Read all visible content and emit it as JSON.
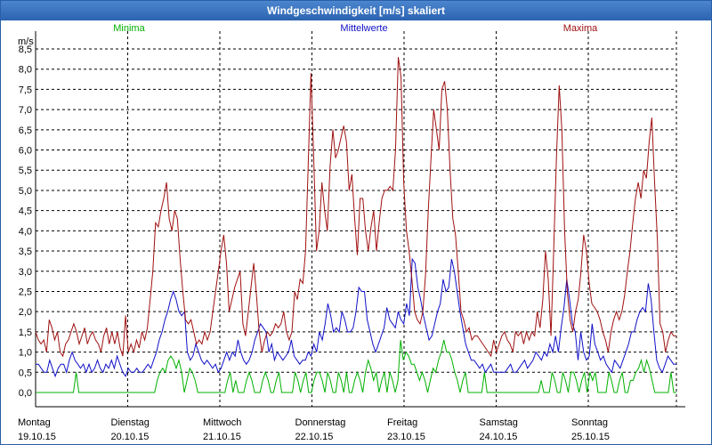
{
  "window": {
    "title": "Windgeschwindigkeit [m/s] skaliert"
  },
  "colors": {
    "min": "#00b000",
    "mean": "#1010c8",
    "max": "#a01010",
    "titlebar": "#2c63b0"
  },
  "chart_data": {
    "type": "line",
    "title": "Windgeschwindigkeit [m/s] skaliert",
    "ylabel": "m/s",
    "xlabel": "",
    "ylim": [
      0,
      8.5
    ],
    "grid": true,
    "legend_position": "top",
    "yticks": [
      "0,0",
      "0,5",
      "1,0",
      "1,5",
      "2,0",
      "2,5",
      "3,0",
      "3,5",
      "4,0",
      "4,5",
      "5,0",
      "5,5",
      "6,0",
      "6,5",
      "7,0",
      "7,5",
      "8,0",
      "8,5"
    ],
    "days": [
      {
        "name": "Montag",
        "date": "19.10.15"
      },
      {
        "name": "Dienstag",
        "date": "20.10.15"
      },
      {
        "name": "Mittwoch",
        "date": "21.10.15"
      },
      {
        "name": "Donnerstag",
        "date": "22.10.15"
      },
      {
        "name": "Freitag",
        "date": "23.10.15"
      },
      {
        "name": "Samstag",
        "date": "24.10.15"
      },
      {
        "name": "Sonntag",
        "date": "25.10.15"
      }
    ],
    "series": [
      {
        "name": "Minima",
        "values": [
          0,
          0,
          0,
          0,
          0,
          0,
          0,
          0,
          0,
          0,
          0,
          0,
          0,
          0,
          0,
          0.5,
          0,
          0,
          0,
          0,
          0,
          0,
          0,
          0,
          0,
          0,
          0,
          0,
          0,
          0,
          0,
          0,
          0,
          0,
          0,
          0,
          0,
          0,
          0,
          0,
          0,
          0,
          0,
          0,
          0,
          0.3,
          0.5,
          0.6,
          0.5,
          0.8,
          0.9,
          0.8,
          0.6,
          0.8,
          0.5,
          0,
          0.3,
          0.6,
          0.5,
          0.3,
          0,
          0,
          0,
          0,
          0,
          0,
          0,
          0,
          0,
          0,
          0,
          0.3,
          0.5,
          0,
          0.3,
          0,
          0,
          0,
          0.3,
          0.5,
          0.3,
          0,
          0,
          0,
          0.3,
          0.5,
          0.3,
          0,
          0,
          0.3,
          0.5,
          0,
          0,
          0,
          0,
          0,
          0.5,
          0.3,
          0,
          0.3,
          0.5,
          0,
          0,
          0.3,
          0.5,
          0.5,
          0.3,
          0,
          0.5,
          0.3,
          0,
          0,
          0.5,
          0.3,
          0,
          0.5,
          0,
          0,
          0.3,
          0.5,
          0.3,
          0,
          0.5,
          0.8,
          0.6,
          0.3,
          0.5,
          0,
          0.3,
          0.5,
          0,
          0.5,
          0.3,
          0,
          0.3,
          1.3,
          0.8,
          1.0,
          0.9,
          0.7,
          0.7,
          0.5,
          0.3,
          0.5,
          0.3,
          0,
          0.3,
          0.6,
          0.5,
          0.8,
          1.0,
          1.3,
          1.0,
          1.0,
          0.8,
          0.5,
          0.3,
          0,
          0.3,
          0.5,
          0,
          0,
          0,
          0,
          0,
          0,
          0.5,
          0,
          0,
          0,
          0,
          0,
          0,
          0,
          0,
          0,
          0,
          0,
          0,
          0,
          0,
          0,
          0,
          0,
          0,
          0,
          0,
          0.3,
          0,
          0,
          0,
          0.5,
          0.3,
          0,
          0,
          0.5,
          0.3,
          0,
          0.5,
          0.5,
          0.3,
          0,
          0.3,
          0.5,
          0,
          0.5,
          0.3,
          0.5,
          0,
          0,
          0,
          0,
          0.5,
          0.3,
          0,
          0,
          0.3,
          0.5,
          0,
          0,
          0.3,
          0.3,
          0.5,
          0.6,
          0.8,
          0.5,
          0.8,
          0.6,
          0.3,
          0,
          0,
          0,
          0,
          0,
          0,
          0.5,
          0,
          0
        ]
      },
      {
        "name": "Mittelwerte",
        "values": [
          0.7,
          0.7,
          0.6,
          0.5,
          0.5,
          0.8,
          0.6,
          0.4,
          0.6,
          0.7,
          0.7,
          0.5,
          0.8,
          1.0,
          0.8,
          0.7,
          0.6,
          0.7,
          0.5,
          0.7,
          0.5,
          0.6,
          0.8,
          0.6,
          0.5,
          0.7,
          0.6,
          0.8,
          0.6,
          0.9,
          0.7,
          0.5,
          0.4,
          0.6,
          0.5,
          0.5,
          0.6,
          0.5,
          0.5,
          0.6,
          0.7,
          0.6,
          0.8,
          1.0,
          1.3,
          1.5,
          1.8,
          2.0,
          2.3,
          2.5,
          2.3,
          2.0,
          1.9,
          2.0,
          1.0,
          0.8,
          0.9,
          1.2,
          1.0,
          0.8,
          0.7,
          0.8,
          0.7,
          0.6,
          0.7,
          0.5,
          0.6,
          0.8,
          1.0,
          0.8,
          1.0,
          0.9,
          1.3,
          1.0,
          0.8,
          0.7,
          0.8,
          1.0,
          1.3,
          1.5,
          1.7,
          1.6,
          1.5,
          1.0,
          1.2,
          0.8,
          1.0,
          0.9,
          0.8,
          0.9,
          1.0,
          1.3,
          0.9,
          0.8,
          0.7,
          0.8,
          0.8,
          1.0,
          0.9,
          1.2,
          1.0,
          1.5,
          1.3,
          1.7,
          2.2,
          1.9,
          1.5,
          1.6,
          1.5,
          2.0,
          1.8,
          1.5,
          1.5,
          1.6,
          2.0,
          2.6,
          2.5,
          2.5,
          1.8,
          1.5,
          1.2,
          1.0,
          1.2,
          1.4,
          1.6,
          2.1,
          1.8,
          1.7,
          1.6,
          2.0,
          1.8,
          1.7,
          2.2,
          1.9,
          3.3,
          3.2,
          2.6,
          2.3,
          1.9,
          1.6,
          1.3,
          1.4,
          1.7,
          2.0,
          2.2,
          2.8,
          2.5,
          2.6,
          3.3,
          3.0,
          2.5,
          2.0,
          1.6,
          1.2,
          1.0,
          0.8,
          0.8,
          0.7,
          0.6,
          0.7,
          0.5,
          0.6,
          0.7,
          0.5,
          0.5,
          0.5,
          0.5,
          0.5,
          0.6,
          0.7,
          0.5,
          0.5,
          0.6,
          0.7,
          0.8,
          0.6,
          0.7,
          0.8,
          1.0,
          0.9,
          0.8,
          1.0,
          0.9,
          1.2,
          1.0,
          1.4,
          1.0,
          1.6,
          2.1,
          2.8,
          2.3,
          1.7,
          1.5,
          0.8,
          1.5,
          1.0,
          0.8,
          0.9,
          1.7,
          1.2,
          1.0,
          0.8,
          0.9,
          0.7,
          0.6,
          0.5,
          0.8,
          0.7,
          0.6,
          0.8,
          1.0,
          1.2,
          1.5,
          1.5,
          1.8,
          2.0,
          2.1,
          2.0,
          2.7,
          2.3,
          1.5,
          0.8,
          0.6,
          0.5,
          0.7,
          0.9,
          0.8,
          0.7,
          0.7
        ]
      },
      {
        "name": "Maxima",
        "values": [
          1.5,
          1.3,
          1.2,
          1.3,
          1.0,
          1.8,
          1.6,
          1.3,
          1.5,
          1.0,
          0.9,
          1.2,
          1.3,
          1.5,
          1.7,
          1.5,
          1.2,
          1.4,
          1.6,
          1.2,
          1.4,
          1.5,
          1.3,
          1.2,
          1.0,
          1.4,
          1.6,
          1.2,
          1.5,
          1.2,
          1.5,
          1.1,
          0.9,
          1.9,
          1.0,
          1.2,
          1.0,
          1.3,
          1.1,
          1.5,
          1.3,
          1.6,
          2.3,
          3.0,
          4.2,
          4.1,
          4.5,
          4.8,
          5.2,
          4.3,
          4.0,
          4.5,
          4.3,
          3.3,
          2.5,
          1.8,
          1.7,
          1.8,
          1.5,
          1.2,
          1.3,
          1.2,
          1.5,
          1.3,
          1.5,
          2.0,
          2.5,
          3.0,
          3.5,
          3.9,
          3.2,
          2.0,
          2.3,
          2.6,
          2.8,
          3.0,
          1.7,
          1.4,
          2.0,
          2.6,
          3.2,
          2.4,
          1.5,
          1.0,
          1.3,
          1.5,
          1.4,
          1.5,
          1.7,
          1.6,
          1.7,
          2.0,
          1.5,
          1.3,
          1.5,
          2.5,
          2.3,
          2.8,
          2.7,
          3.5,
          5.7,
          7.9,
          5.8,
          3.5,
          4.0,
          5.2,
          4.5,
          4.0,
          5.6,
          6.5,
          5.8,
          6.0,
          6.3,
          6.6,
          6.2,
          5.0,
          5.4,
          4.3,
          3.4,
          4.8,
          4.8,
          4.0,
          3.5,
          4.1,
          4.5,
          3.5,
          4.2,
          4.8,
          5.0,
          5.0,
          5.1,
          5.0,
          6.0,
          8.3,
          7.8,
          5.2,
          4.0,
          3.5,
          2.8,
          2.0,
          1.8,
          1.7,
          2.0,
          2.9,
          4.5,
          5.8,
          7.0,
          6.5,
          6.0,
          7.5,
          7.7,
          7.0,
          5.5,
          4.3,
          3.9,
          3.0,
          2.0,
          1.8,
          1.5,
          1.6,
          1.3,
          1.4,
          1.4,
          1.3,
          1.2,
          1.1,
          1.0,
          0.9,
          1.3,
          1.0,
          1.2,
          1.4,
          1.5,
          1.3,
          1.2,
          1.0,
          1.5,
          1.4,
          1.5,
          1.2,
          1.5,
          1.3,
          1.5,
          1.4,
          2.0,
          1.6,
          2.3,
          3.5,
          2.8,
          1.4,
          3.5,
          5.8,
          7.6,
          6.5,
          4.0,
          2.5,
          1.8,
          1.5,
          2.0,
          2.3,
          3.0,
          3.9,
          3.5,
          2.7,
          2.2,
          2.1,
          2.0,
          1.8,
          1.5,
          1.3,
          1.0,
          1.5,
          1.8,
          2.0,
          1.8,
          2.0,
          2.4,
          3.0,
          3.5,
          4.2,
          4.8,
          5.2,
          4.8,
          5.5,
          5.3,
          6.2,
          6.8,
          5.2,
          3.8,
          1.7,
          1.5,
          1.0,
          1.3,
          1.5,
          1.4,
          1.4
        ]
      }
    ]
  }
}
